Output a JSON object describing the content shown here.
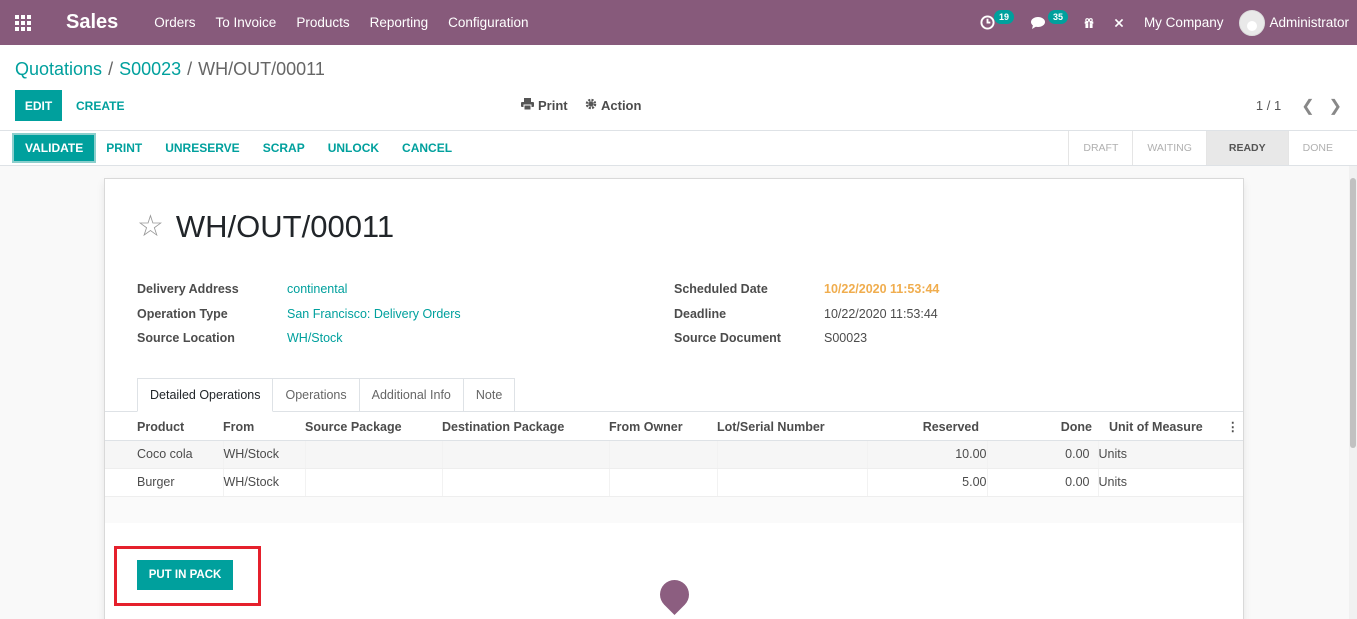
{
  "navbar": {
    "app_name": "Sales",
    "menu": [
      "Orders",
      "To Invoice",
      "Products",
      "Reporting",
      "Configuration"
    ],
    "activity_count": "19",
    "message_count": "35",
    "company": "My Company",
    "user": "Administrator",
    "bg_color": "#875a7b",
    "icons": [
      "apps-grid-icon",
      "clock-icon",
      "chat-icon",
      "gift-icon",
      "tools-icon"
    ]
  },
  "breadcrumb": {
    "items": [
      "Quotations",
      "S00023"
    ],
    "current": "WH/OUT/00011",
    "separator": "/"
  },
  "toolbar": {
    "edit_label": "EDIT",
    "create_label": "CREATE",
    "print_label": "Print",
    "action_label": "Action",
    "pager": "1 / 1"
  },
  "statusbar": {
    "buttons": [
      "VALIDATE",
      "PRINT",
      "UNRESERVE",
      "SCRAP",
      "UNLOCK",
      "CANCEL"
    ],
    "stages": [
      "DRAFT",
      "WAITING",
      "READY",
      "DONE"
    ],
    "active_stage": "READY"
  },
  "record": {
    "title": "WH/OUT/00011",
    "left_fields": [
      {
        "label": "Delivery Address",
        "value": "continental",
        "style": "link"
      },
      {
        "label": "Operation Type",
        "value": "San Francisco: Delivery Orders",
        "style": "link"
      },
      {
        "label": "Source Location",
        "value": "WH/Stock",
        "style": "link"
      }
    ],
    "right_fields": [
      {
        "label": "Scheduled Date",
        "value": "10/22/2020 11:53:44",
        "style": "warn"
      },
      {
        "label": "Deadline",
        "value": "10/22/2020 11:53:44",
        "style": "plain"
      },
      {
        "label": "Source Document",
        "value": "S00023",
        "style": "plain"
      }
    ]
  },
  "tabs": [
    "Detailed Operations",
    "Operations",
    "Additional Info",
    "Note"
  ],
  "active_tab": "Detailed Operations",
  "operations": {
    "columns": [
      "Product",
      "From",
      "Source Package",
      "Destination Package",
      "From Owner",
      "Lot/Serial Number",
      "Reserved",
      "Done",
      "Unit of Measure"
    ],
    "rows": [
      [
        "Coco cola",
        "WH/Stock",
        "",
        "",
        "",
        "",
        "10.00",
        "0.00",
        "Units"
      ],
      [
        "Burger",
        "WH/Stock",
        "",
        "",
        "",
        "",
        "5.00",
        "0.00",
        "Units"
      ]
    ]
  },
  "put_in_pack_label": "PUT IN PACK",
  "accent_color": "#00a09d",
  "highlight_color": "#e5202c"
}
